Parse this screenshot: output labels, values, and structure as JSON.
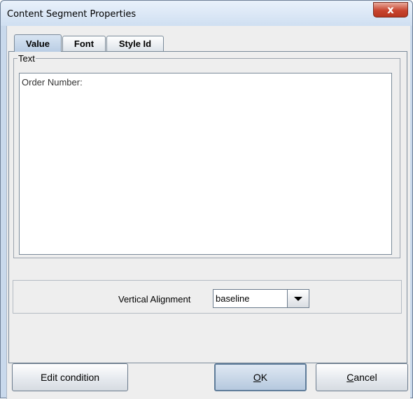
{
  "window": {
    "title": "Content Segment Properties",
    "close_label": "x"
  },
  "tabs": [
    {
      "label": "Value",
      "selected": true
    },
    {
      "label": "Font",
      "selected": false
    },
    {
      "label": "Style Id",
      "selected": false
    }
  ],
  "text_group": {
    "title": "Text",
    "value": "Order Number:"
  },
  "alignment": {
    "label": "Vertical Alignment",
    "selected": "baseline"
  },
  "buttons": {
    "edit_condition": "Edit condition",
    "ok_mnemonic": "O",
    "ok_rest": "K",
    "cancel_mnemonic": "C",
    "cancel_rest": "ancel"
  },
  "colors": {
    "title_bar": "#cfdff1",
    "close_button": "#c8452f",
    "selected_tab": "#b9cde4",
    "panel_background": "#eeeeee"
  }
}
